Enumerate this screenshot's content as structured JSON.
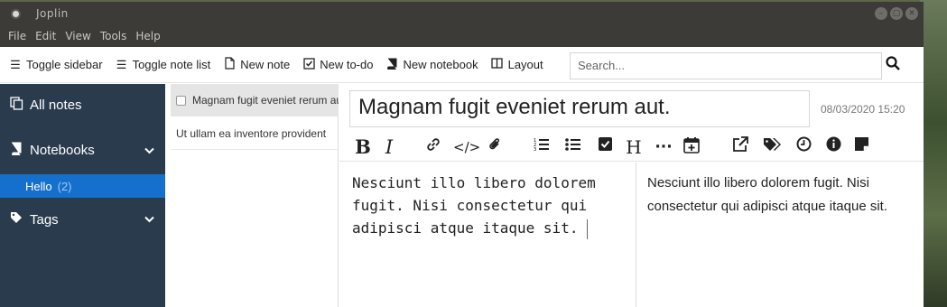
{
  "window": {
    "title": "Joplin",
    "controls": [
      "–",
      "▢",
      "✕"
    ]
  },
  "menu": [
    "File",
    "Edit",
    "View",
    "Tools",
    "Help"
  ],
  "toolbar": {
    "toggle_sidebar": "Toggle sidebar",
    "toggle_note_list": "Toggle note list",
    "new_note": "New note",
    "new_todo": "New to-do",
    "new_notebook": "New notebook",
    "layout": "Layout",
    "search_placeholder": "Search..."
  },
  "sidebar": {
    "all_notes": "All notes",
    "notebooks": "Notebooks",
    "notebook_items": [
      {
        "name": "Hello",
        "count": "(2)"
      }
    ],
    "tags": "Tags",
    "accent": "#1470cc",
    "background": "#2b3b4e"
  },
  "notes": [
    {
      "title": "Magnam fugit eveniet rerum aut.",
      "todo": true,
      "selected": true
    },
    {
      "title": "Ut ullam ea inventore provident",
      "todo": false,
      "selected": false
    }
  ],
  "editor": {
    "title": "Magnam fugit eveniet rerum aut.",
    "date": "08/03/2020 15:20",
    "markdown_lines": [
      "Nesciunt illo libero dolorem",
      "fugit. Nisi consectetur qui",
      "adipisci atque itaque sit."
    ],
    "rendered": "Nesciunt illo libero dolorem fugit. Nisi consectetur qui adipisci atque itaque sit."
  }
}
